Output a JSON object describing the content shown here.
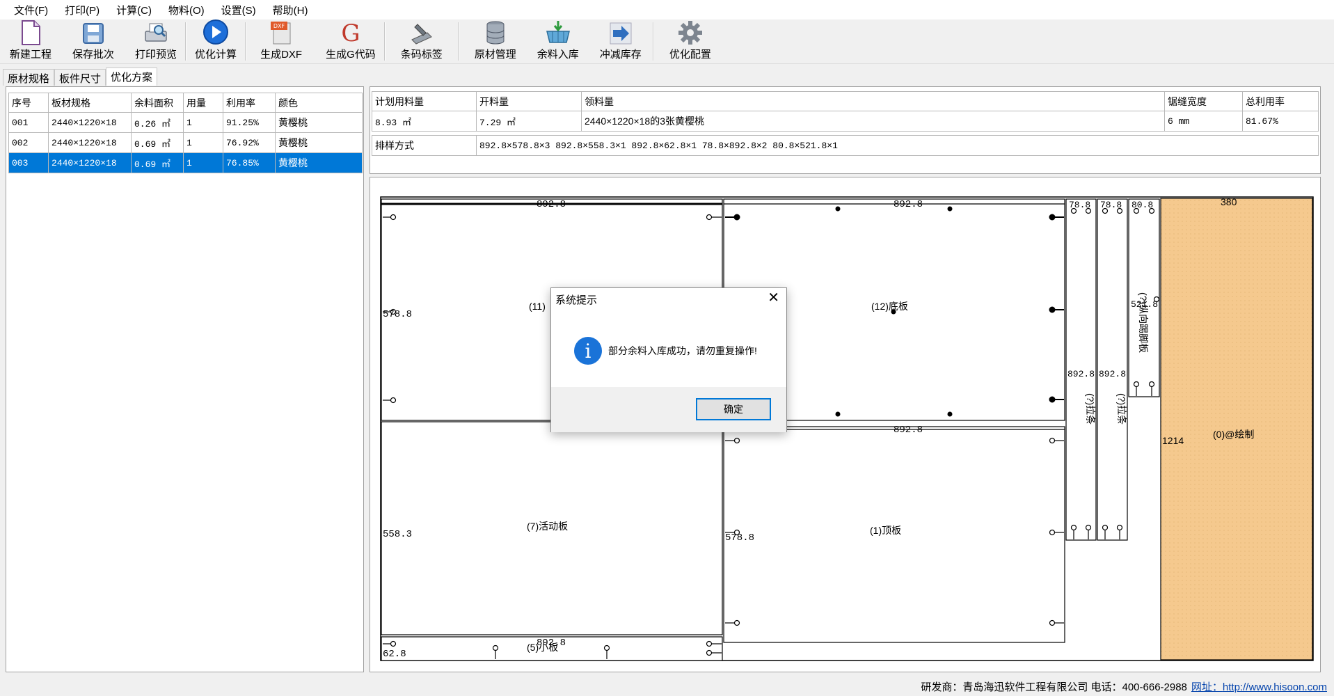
{
  "menu": [
    "文件(F)",
    "打印(P)",
    "计算(C)",
    "物料(O)",
    "设置(S)",
    "帮助(H)"
  ],
  "toolbar": [
    {
      "label": "新建工程",
      "icon": "new-file-icon"
    },
    {
      "label": "保存批次",
      "icon": "save-disk-icon"
    },
    {
      "label": "打印预览",
      "icon": "print-preview-icon"
    },
    {
      "label": "优化计算",
      "icon": "play-icon"
    },
    {
      "label": "生成DXF",
      "icon": "dxf-icon"
    },
    {
      "label": "生成G代码",
      "icon": "g-code-icon"
    },
    {
      "label": "条码标签",
      "icon": "barcode-scanner-icon"
    },
    {
      "label": "原材管理",
      "icon": "database-icon"
    },
    {
      "label": "余料入库",
      "icon": "basket-icon"
    },
    {
      "label": "冲减库存",
      "icon": "arrow-right-icon"
    },
    {
      "label": "优化配置",
      "icon": "gear-icon"
    }
  ],
  "tabs": [
    "原材规格",
    "板件尺寸",
    "优化方案"
  ],
  "left_table": {
    "headers": [
      "序号",
      "板材规格",
      "余料面积",
      "用量",
      "利用率",
      "颜色"
    ],
    "rows": [
      [
        "001",
        "2440×1220×18",
        "0.26 ㎡",
        "1",
        "91.25%",
        "黄樱桃"
      ],
      [
        "002",
        "2440×1220×18",
        "0.69 ㎡",
        "1",
        "76.92%",
        "黄樱桃"
      ],
      [
        "003",
        "2440×1220×18",
        "0.69 ㎡",
        "1",
        "76.85%",
        "黄樱桃"
      ]
    ],
    "selected_index": 2
  },
  "summary": {
    "headers": [
      "计划用料量",
      "开料量",
      "领料量",
      "锯缝宽度",
      "总利用率"
    ],
    "values": [
      "8.93 ㎡",
      "7.29 ㎡",
      "2440×1220×18的3张黄樱桃",
      "6 mm",
      "81.67%"
    ],
    "layout_label": "排样方式",
    "layout_value": "892.8×578.8×3 892.8×558.3×1 892.8×62.8×1 78.8×892.8×2 80.8×521.8×1"
  },
  "canvas": {
    "texts": {
      "p11_w": "892.8",
      "p11_h": "578.8",
      "p11_name": "(11)",
      "p12_w": "892.8",
      "p12_name": "(12)底板",
      "p7_h": "558.3",
      "p7_name": "(7)活动板",
      "p1_w": "892.8",
      "p1_h": "578.8",
      "p1_name": "(1)顶板",
      "p5_w": "892.8",
      "p5_h": "62.8",
      "p5_name": "(5)小板",
      "s1_w": "78.8",
      "s1_h": "892.8",
      "s1_name": "(?)拉条",
      "s2_w": "78.8",
      "s2_h": "892.8",
      "s2_name": "(?)拉条",
      "s3_w": "80.8",
      "s3_h": "521.8",
      "s3_name": "(?)纵向踢脚板",
      "rem_w": "380",
      "rem_h": "1214",
      "rem_name": "(0)@绘制"
    },
    "remnant_color": "#f5c98e"
  },
  "dialog": {
    "title": "系统提示",
    "message": "部分余料入库成功，请勿重复操作!",
    "ok": "确定"
  },
  "status": {
    "text": "研发商：青岛海迅软件工程有限公司 电话：400-666-2988",
    "link_label": "网址：",
    "link": "http://www.hisoon.com"
  }
}
